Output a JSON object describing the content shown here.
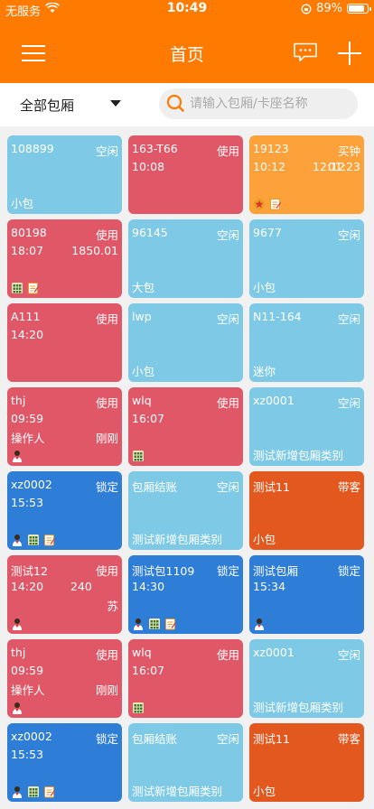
{
  "status_bar": {
    "carrier": "无服务",
    "time": "10:49",
    "battery": "89%"
  },
  "nav": {
    "title": "首页"
  },
  "filter": {
    "dropdown": "全部包厢",
    "search_placeholder": "请输入包厢/卡座名称"
  },
  "colors": {
    "idle": "#7ecae6",
    "in_use": "#e05868",
    "buy": "#fda23a",
    "locked": "#2e7dd7",
    "guest": "#e3581f",
    "accent": "#ff7a00"
  },
  "cards": [
    {
      "name": "108899",
      "status": "空闲",
      "bottom": "小包",
      "color": "idle"
    },
    {
      "name": "163-T66",
      "status": "使用",
      "l2": "10:08",
      "color": "in_use"
    },
    {
      "name": "19123",
      "status": "买钟",
      "l2": "10:12",
      "l2m": "12:12",
      "l2r": "01:23",
      "icons": [
        "star-icon",
        "note-icon"
      ],
      "color": "buy"
    },
    {
      "name": "80198",
      "status": "使用",
      "l2": "18:07",
      "l2r": "1850.01",
      "icons": [
        "calculator-icon",
        "note-icon"
      ],
      "color": "in_use"
    },
    {
      "name": "96145",
      "status": "空闲",
      "bottom": "大包",
      "color": "idle"
    },
    {
      "name": "9677",
      "status": "空闲",
      "bottom": "小包",
      "color": "idle"
    },
    {
      "name": "A111",
      "status": "使用",
      "l2": "14:20",
      "color": "in_use"
    },
    {
      "name": "lwp",
      "status": "空闲",
      "bottom": "小包",
      "color": "idle"
    },
    {
      "name": "N11-164",
      "status": "空闲",
      "bottom": "迷你",
      "color": "idle"
    },
    {
      "name": "thj",
      "status": "使用",
      "l2": "09:59",
      "l3": "操作人",
      "l3r": "刚刚",
      "icons": [
        "waiter-icon"
      ],
      "color": "in_use"
    },
    {
      "name": "wlq",
      "status": "使用",
      "l2": "16:07",
      "icons": [
        "calculator-icon"
      ],
      "color": "in_use"
    },
    {
      "name": "xz0001",
      "status": "空闲",
      "bottom": "测试新增包厢类别",
      "color": "idle"
    },
    {
      "name": "xz0002",
      "status": "锁定",
      "l2": "15:53",
      "icons": [
        "waiter-icon",
        "calculator-icon",
        "note-icon"
      ],
      "color": "locked"
    },
    {
      "name": "包厢结账",
      "status": "空闲",
      "bottom": "测试新增包厢类别",
      "color": "idle"
    },
    {
      "name": "测试11",
      "status": "带客",
      "bottom": "小包",
      "color": "guest"
    },
    {
      "name": "测试12",
      "status": "使用",
      "l2": "14:20",
      "l2m": "240",
      "l3r": "苏",
      "icons": [
        "waiter-icon"
      ],
      "color": "in_use"
    },
    {
      "name": "测试包1109",
      "status": "锁定",
      "l2": "14:30",
      "icons": [
        "waiter-icon",
        "calculator-icon",
        "note-icon"
      ],
      "color": "locked"
    },
    {
      "name": "测试包厢",
      "status": "锁定",
      "l2": "15:34",
      "icons": [
        "waiter-icon"
      ],
      "color": "locked"
    },
    {
      "name": "thj",
      "status": "使用",
      "l2": "09:59",
      "l3": "操作人",
      "l3r": "刚刚",
      "icons": [
        "waiter-icon"
      ],
      "color": "in_use"
    },
    {
      "name": "wlq",
      "status": "使用",
      "l2": "16:07",
      "icons": [
        "calculator-icon"
      ],
      "color": "in_use"
    },
    {
      "name": "xz0001",
      "status": "空闲",
      "bottom": "测试新增包厢类别",
      "color": "idle"
    },
    {
      "name": "xz0002",
      "status": "锁定",
      "l2": "15:53",
      "icons": [
        "waiter-icon",
        "calculator-icon",
        "note-icon"
      ],
      "color": "locked"
    },
    {
      "name": "包厢结账",
      "status": "空闲",
      "bottom": "测试新增包厢类别",
      "color": "idle"
    },
    {
      "name": "测试11",
      "status": "带客",
      "bottom": "小包",
      "color": "guest"
    }
  ]
}
